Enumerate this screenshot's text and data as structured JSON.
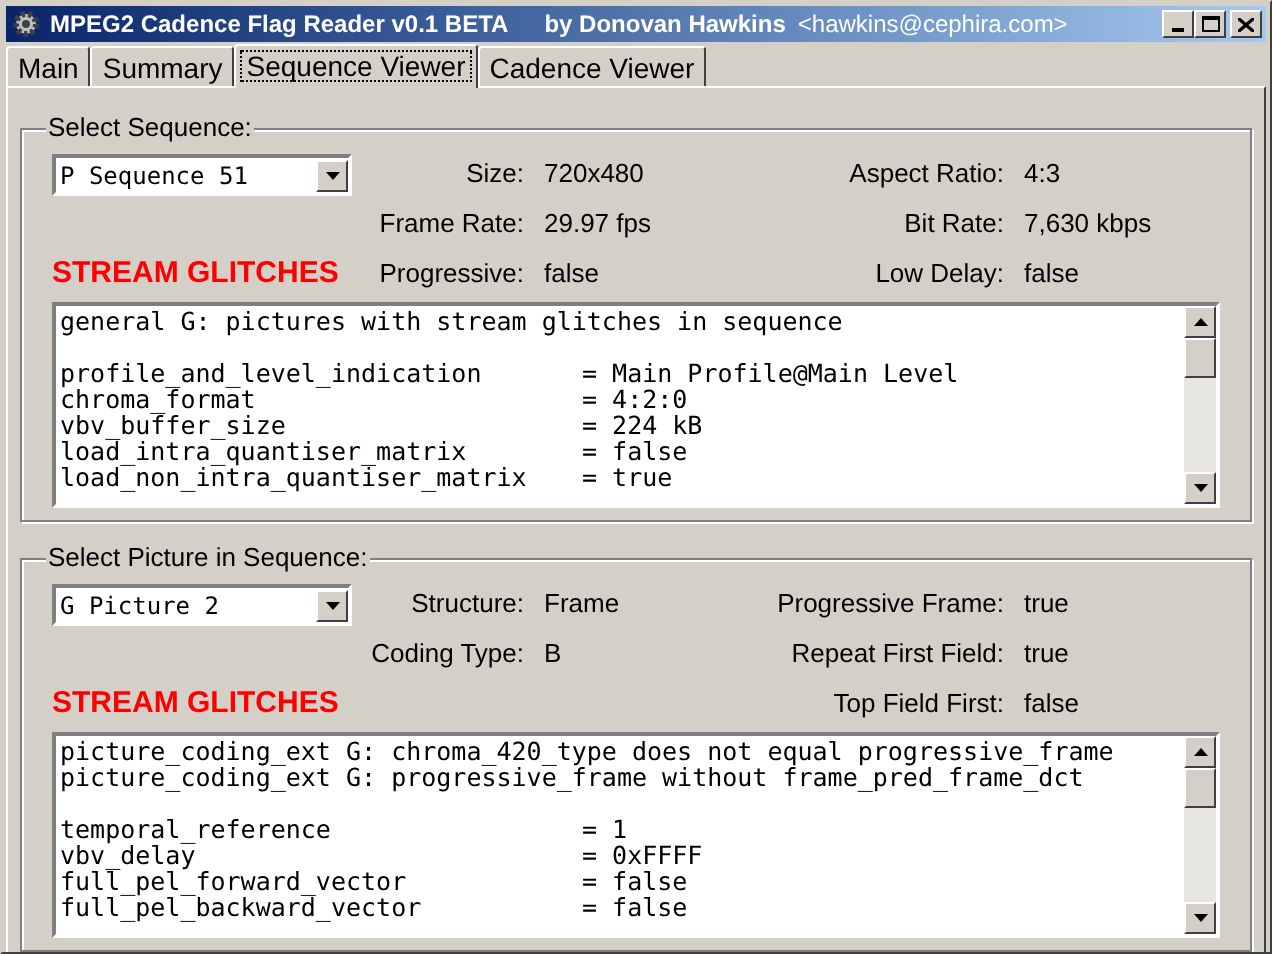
{
  "window": {
    "title": "MPEG2 Cadence Flag Reader v0.1 BETA",
    "author": "by Donovan Hawkins",
    "email": "<hawkins@cephira.com>"
  },
  "tabs": [
    {
      "label": "Main",
      "selected": false
    },
    {
      "label": "Summary",
      "selected": false
    },
    {
      "label": "Sequence Viewer",
      "selected": true
    },
    {
      "label": "Cadence Viewer",
      "selected": false
    }
  ],
  "groups": [
    {
      "title": "Select Sequence:",
      "dropdown": "P Sequence 51",
      "alert": "STREAM GLITCHES",
      "rows": [
        {
          "left": {
            "label": "Size:",
            "value": "720x480"
          },
          "right": {
            "label": "Aspect Ratio:",
            "value": "4:3"
          }
        },
        {
          "left": {
            "label": "Frame Rate:",
            "value": "29.97 fps"
          },
          "right": {
            "label": "Bit Rate:",
            "value": "7,630 kbps"
          }
        },
        {
          "left": {
            "label": "Progressive:",
            "value": "false"
          },
          "right": {
            "label": "Low Delay:",
            "value": "false"
          }
        }
      ],
      "messages": [
        "general G: pictures with stream glitches in sequence"
      ],
      "fields": [
        {
          "name": "profile_and_level_indication",
          "value": "= Main Profile@Main Level"
        },
        {
          "name": "chroma_format",
          "value": "= 4:2:0"
        },
        {
          "name": "vbv_buffer_size",
          "value": "= 224 kB"
        },
        {
          "name": "load_intra_quantiser_matrix",
          "value": "= false"
        },
        {
          "name": "load_non_intra_quantiser_matrix",
          "value": "= true"
        }
      ]
    },
    {
      "title": "Select Picture in Sequence:",
      "dropdown": "G Picture 2",
      "alert": "STREAM GLITCHES",
      "rows": [
        {
          "left": {
            "label": "Structure:",
            "value": "Frame"
          },
          "right": {
            "label": "Progressive Frame:",
            "value": "true"
          }
        },
        {
          "left": {
            "label": "Coding Type:",
            "value": "B"
          },
          "right": {
            "label": "Repeat First Field:",
            "value": "true"
          }
        },
        {
          "right": {
            "label": "Top Field First:",
            "value": "false"
          }
        }
      ],
      "messages": [
        "picture_coding_ext G: chroma_420_type does not equal progressive_frame",
        "picture_coding_ext G: progressive_frame without frame_pred_frame_dct"
      ],
      "fields": [
        {
          "name": "temporal_reference",
          "value": "= 1"
        },
        {
          "name": "vbv_delay",
          "value": "= 0xFFFF"
        },
        {
          "name": "full_pel_forward_vector",
          "value": "= false"
        },
        {
          "name": "full_pel_backward_vector",
          "value": "= false"
        }
      ]
    }
  ]
}
